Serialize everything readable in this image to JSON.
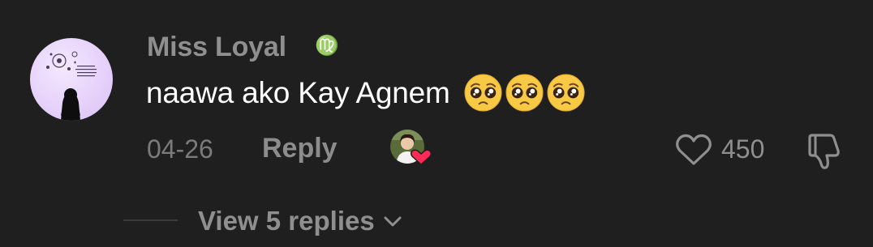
{
  "comment": {
    "username": "Miss Loyal",
    "zodiac_symbol": "♍",
    "text": "naawa ako Kay Agnem",
    "emojis": [
      "pleading-face",
      "pleading-face",
      "pleading-face"
    ],
    "date": "04-26",
    "reply_label": "Reply",
    "like_count": "450",
    "view_replies_label": "View 5 replies"
  },
  "icons": {
    "like": "heart-outline-icon",
    "dislike": "thumbs-down-icon",
    "expand": "chevron-down-icon",
    "creator_liked": "creator-avatar-heart-icon"
  },
  "colors": {
    "background": "#1f1f1f",
    "username": "#8f8f8f",
    "comment_text": "#ffffff",
    "meta_text": "#7b7b7b",
    "heart_badge": "#ff2a55"
  }
}
